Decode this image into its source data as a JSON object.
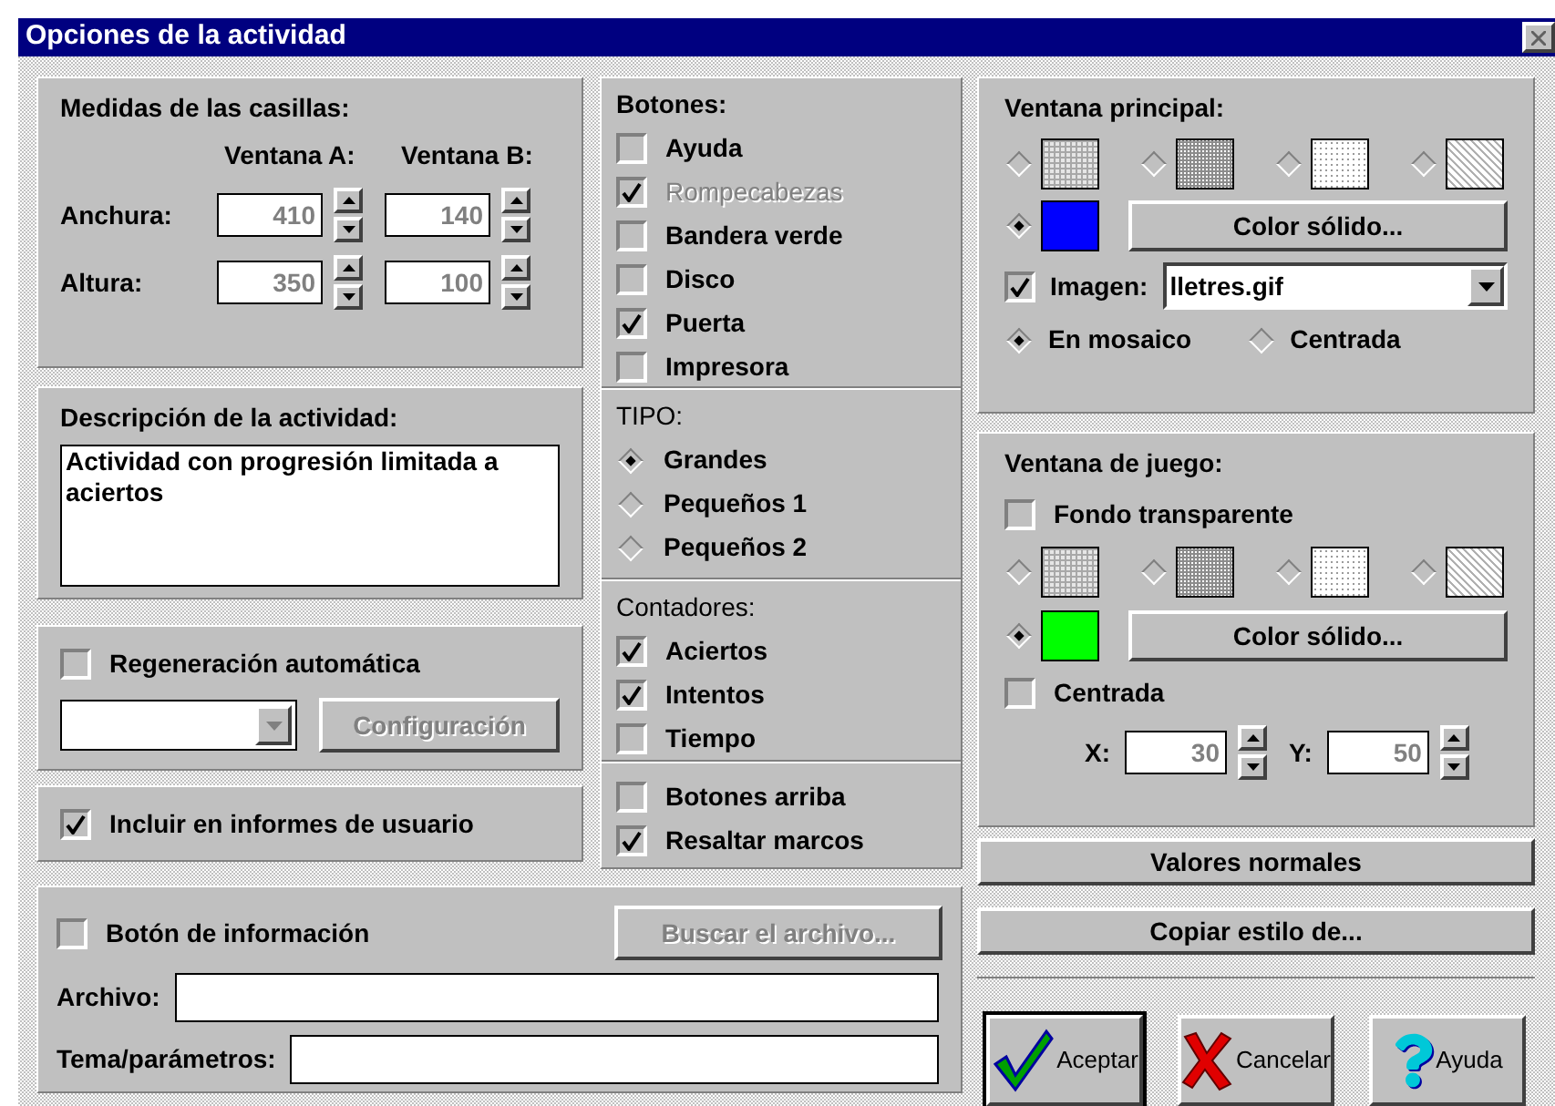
{
  "window": {
    "title": "Opciones de la actividad"
  },
  "sizes": {
    "title": "Medidas de las casillas:",
    "columns": [
      "Ventana A:",
      "Ventana B:"
    ],
    "rows": [
      {
        "label": "Anchura:",
        "values": [
          "410",
          "140"
        ]
      },
      {
        "label": "Altura:",
        "values": [
          "350",
          "100"
        ]
      }
    ]
  },
  "description": {
    "title": "Descripción de la actividad:",
    "value": "Actividad con progresión limitada a aciertos"
  },
  "regeneration": {
    "label": "Regeneración automática",
    "checked": false,
    "config_label": "Configuración",
    "disabled": true
  },
  "include_reports": {
    "label": "Incluir en informes de usuario",
    "checked": true
  },
  "info_button": {
    "label": "Botón de información",
    "checked": false,
    "browse_label": "Buscar el archivo...",
    "browse_disabled": true,
    "fields": [
      {
        "label": "Archivo:"
      },
      {
        "label": "Tema/parámetros:"
      }
    ]
  },
  "buttons_group": {
    "title": "Botones:",
    "items": [
      {
        "label": "Ayuda",
        "checked": false,
        "disabled": false
      },
      {
        "label": "Rompecabezas",
        "checked": true,
        "disabled": true
      },
      {
        "label": "Bandera verde",
        "checked": false,
        "disabled": false
      },
      {
        "label": "Disco",
        "checked": false,
        "disabled": false
      },
      {
        "label": "Puerta",
        "checked": true,
        "disabled": false
      },
      {
        "label": "Impresora",
        "checked": false,
        "disabled": false
      }
    ]
  },
  "type_group": {
    "title": "TIPO:",
    "options": [
      {
        "label": "Grandes",
        "selected": true
      },
      {
        "label": "Pequeños 1",
        "selected": false
      },
      {
        "label": "Pequeños 2",
        "selected": false
      }
    ]
  },
  "counters": {
    "title": "Contadores:",
    "items": [
      {
        "label": "Aciertos",
        "checked": true
      },
      {
        "label": "Intentos",
        "checked": true
      },
      {
        "label": "Tiempo",
        "checked": false
      }
    ]
  },
  "extras": [
    {
      "label": "Botones arriba",
      "checked": false
    },
    {
      "label": "Resaltar marcos",
      "checked": true
    }
  ],
  "main_window": {
    "title": "Ventana principal:",
    "patterns": [
      {
        "kind": "grid",
        "selected": false
      },
      {
        "kind": "dense",
        "selected": false
      },
      {
        "kind": "dots",
        "selected": false
      },
      {
        "kind": "hatch",
        "selected": false
      }
    ],
    "solid": {
      "selected": true,
      "color": "#0000ff",
      "button": "Color sólido..."
    },
    "image": {
      "label": "Imagen:",
      "checked": true,
      "value": "lletres.gif"
    },
    "layout_options": [
      {
        "label": "En mosaico",
        "selected": true
      },
      {
        "label": "Centrada",
        "selected": false
      }
    ]
  },
  "game_window": {
    "title": "Ventana de juego:",
    "transparent": {
      "label": "Fondo transparente",
      "checked": false
    },
    "patterns": [
      {
        "kind": "grid",
        "selected": false
      },
      {
        "kind": "dense",
        "selected": false
      },
      {
        "kind": "dots",
        "selected": false
      },
      {
        "kind": "hatch",
        "selected": false
      }
    ],
    "solid": {
      "selected": true,
      "color": "#00ff00",
      "button": "Color sólido..."
    },
    "centered": {
      "label": "Centrada",
      "checked": false
    },
    "position": [
      {
        "label": "X:",
        "value": "30"
      },
      {
        "label": "Y:",
        "value": "50"
      }
    ]
  },
  "side_buttons": [
    "Valores normales",
    "Copiar estilo de..."
  ],
  "dialog_buttons": [
    {
      "kind": "accept",
      "label": "Aceptar",
      "default": true
    },
    {
      "kind": "cancel",
      "label": "Cancelar",
      "default": false
    },
    {
      "kind": "help",
      "label": "Ayuda",
      "default": false
    }
  ]
}
